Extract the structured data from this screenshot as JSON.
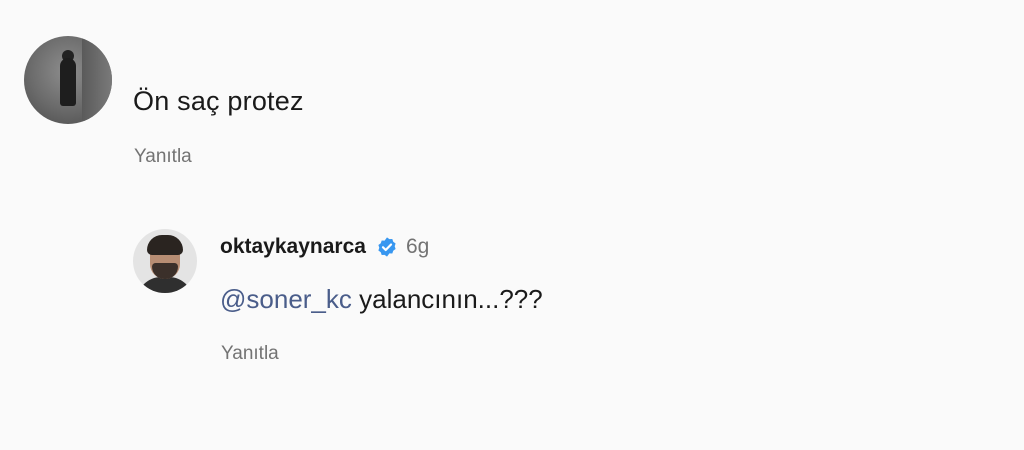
{
  "comments": [
    {
      "text": "Ön saç protez",
      "reply_label": "Yanıtla"
    }
  ],
  "reply": {
    "username": "oktaykaynarca",
    "verified": true,
    "time": "6g",
    "mention": "@soner_kc",
    "text": "yalancının...???",
    "reply_label": "Yanıtla"
  },
  "colors": {
    "verified_badge": "#3897f0",
    "mention": "#4a5d8a",
    "muted": "#737373"
  },
  "icons": {
    "verified": "verified-badge-icon"
  }
}
